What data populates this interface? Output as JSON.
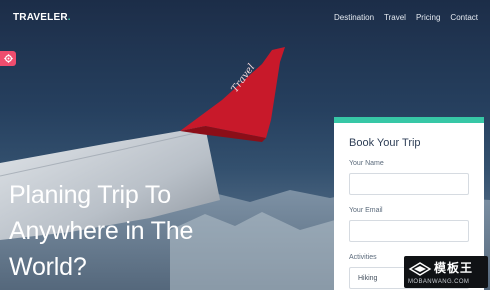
{
  "brand": {
    "logo_text": "TRAVELER",
    "logo_dot": "."
  },
  "nav": {
    "items": [
      {
        "label": "Destination"
      },
      {
        "label": "Travel"
      },
      {
        "label": "Pricing"
      },
      {
        "label": "Contact"
      }
    ]
  },
  "hero": {
    "headline": "Planing Trip To Anywhere in The World?",
    "wing_text": "Travel"
  },
  "booking": {
    "title": "Book Your Trip",
    "name_label": "Your Name",
    "name_value": "",
    "email_label": "Your Email",
    "email_value": "",
    "activities_label": "Activities",
    "activities_value": "Hiking"
  },
  "watermark": {
    "title": "模板王",
    "url": "MOBANWANG.COM"
  },
  "colors": {
    "accent": "#37c7a6",
    "settings": "#ef4d6e",
    "wing": "#c8192a"
  },
  "icons": {
    "settings": "gear-icon"
  }
}
